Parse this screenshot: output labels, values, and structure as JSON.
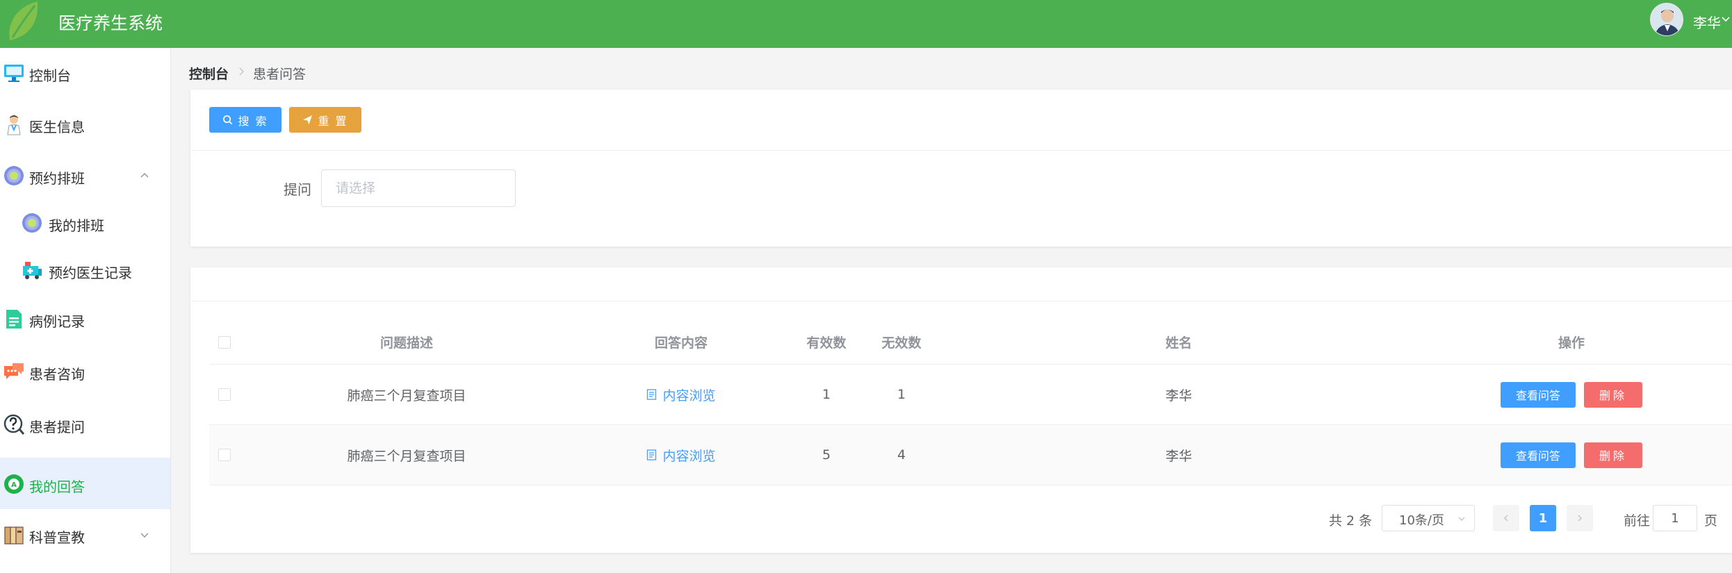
{
  "header": {
    "app_title": "医疗养生系统",
    "user_name": "李华",
    "brand_color": "#4caf50"
  },
  "sidebar": {
    "items": [
      {
        "label": "控制台",
        "icon": "monitor-icon"
      },
      {
        "label": "医生信息",
        "icon": "doctor-icon"
      },
      {
        "label": "预约排班",
        "icon": "flower-icon",
        "expanded": true
      },
      {
        "label": "我的排班",
        "icon": "flower-icon"
      },
      {
        "label": "预约医生记录",
        "icon": "ambulance-icon"
      },
      {
        "label": "病例记录",
        "icon": "document-icon"
      },
      {
        "label": "患者咨询",
        "icon": "chat-icon"
      },
      {
        "label": "患者提问",
        "icon": "question-icon"
      },
      {
        "label": "我的回答",
        "icon": "answer-icon",
        "active": true
      },
      {
        "label": "科普宣教",
        "icon": "books-icon",
        "expanded": false
      }
    ]
  },
  "breadcrumb": {
    "home": "控制台",
    "current": "患者问答"
  },
  "search": {
    "search_label": "搜 索",
    "reset_label": "重 置",
    "field_label": "提问",
    "field_placeholder": "请选择"
  },
  "table": {
    "columns": [
      "问题描述",
      "回答内容",
      "有效数",
      "无效数",
      "姓名",
      "操作"
    ],
    "rows": [
      {
        "question": "肺癌三个月复查项目",
        "answer": "内容浏览",
        "valid": "1",
        "invalid": "1",
        "name": "李华",
        "view_label": "查看问答",
        "delete_label": "删除"
      },
      {
        "question": "肺癌三个月复查项目",
        "answer": "内容浏览",
        "valid": "5",
        "invalid": "4",
        "name": "李华",
        "view_label": "查看问答",
        "delete_label": "删除"
      }
    ]
  },
  "pagination": {
    "total": "共 2 条",
    "page_size": "10条/页",
    "current_page": "1",
    "goto_label": "前往",
    "goto_value": "1",
    "page_unit": "页"
  },
  "colors": {
    "primary": "#409eff",
    "warning": "#e6a23c",
    "danger": "#f56c6c",
    "active_text": "#1fb14c"
  }
}
